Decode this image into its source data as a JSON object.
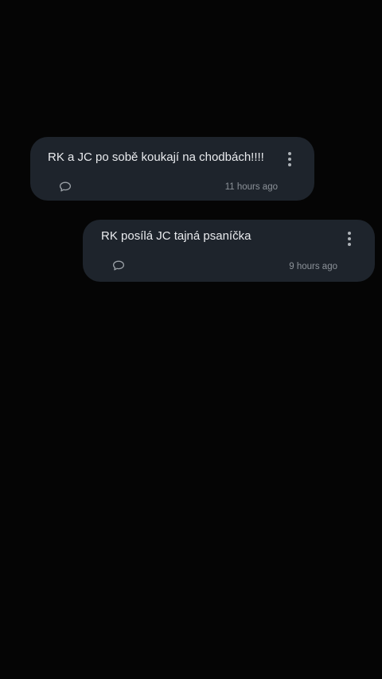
{
  "posts": [
    {
      "text": "RK a JC po sobě koukají na chodbách!!!!",
      "time": "11 hours ago",
      "comment_icon": "comment-bubble-icon",
      "menu_icon": "more-vertical-icon"
    },
    {
      "text": "RK posílá JC tajná psaníčka",
      "time": "9 hours ago",
      "comment_icon": "comment-bubble-icon",
      "menu_icon": "more-vertical-icon"
    }
  ],
  "colors": {
    "background": "#050505",
    "card": "#1e242c",
    "text": "#e9ebee",
    "muted": "#8c9299"
  }
}
